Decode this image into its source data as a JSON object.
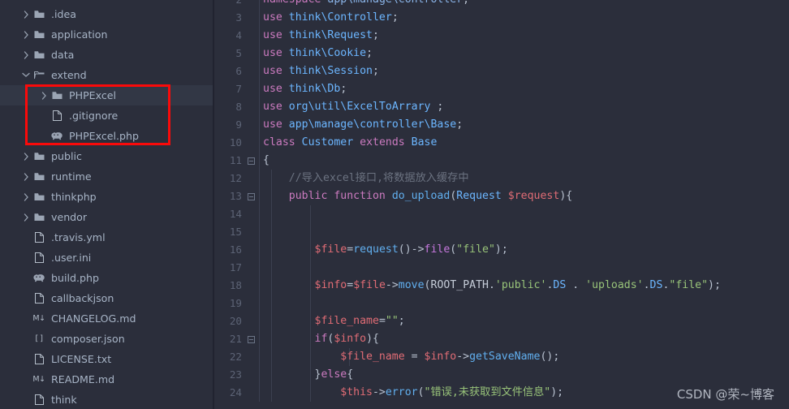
{
  "sidebar": {
    "name": "project-file-tree",
    "items": [
      {
        "label": ".idea",
        "indent": 1,
        "icon": "folder-icon",
        "arrow": "chevron-right",
        "selected": false
      },
      {
        "label": "application",
        "indent": 1,
        "icon": "folder-icon",
        "arrow": "chevron-right",
        "selected": false
      },
      {
        "label": "data",
        "indent": 1,
        "icon": "folder-icon",
        "arrow": "chevron-right",
        "selected": false
      },
      {
        "label": "extend",
        "indent": 1,
        "icon": "folder-open-icon",
        "arrow": "chevron-down",
        "selected": false
      },
      {
        "label": "PHPExcel",
        "indent": 2,
        "icon": "folder-icon",
        "arrow": "chevron-right",
        "selected": true
      },
      {
        "label": ".gitignore",
        "indent": 2,
        "icon": "file-icon",
        "arrow": "",
        "selected": false
      },
      {
        "label": "PHPExcel.php",
        "indent": 2,
        "icon": "php-elephant-icon",
        "arrow": "",
        "selected": false
      },
      {
        "label": "public",
        "indent": 1,
        "icon": "folder-icon",
        "arrow": "chevron-right",
        "selected": false
      },
      {
        "label": "runtime",
        "indent": 1,
        "icon": "folder-icon",
        "arrow": "chevron-right",
        "selected": false
      },
      {
        "label": "thinkphp",
        "indent": 1,
        "icon": "folder-icon",
        "arrow": "chevron-right",
        "selected": false
      },
      {
        "label": "vendor",
        "indent": 1,
        "icon": "folder-icon",
        "arrow": "chevron-right",
        "selected": false
      },
      {
        "label": ".travis.yml",
        "indent": 1,
        "icon": "file-icon",
        "arrow": "",
        "selected": false
      },
      {
        "label": ".user.ini",
        "indent": 1,
        "icon": "file-icon",
        "arrow": "",
        "selected": false
      },
      {
        "label": "build.php",
        "indent": 1,
        "icon": "php-elephant-icon",
        "arrow": "",
        "selected": false
      },
      {
        "label": "callbackjson",
        "indent": 1,
        "icon": "file-icon",
        "arrow": "",
        "selected": false
      },
      {
        "label": "CHANGELOG.md",
        "indent": 1,
        "icon": "markdown-icon",
        "arrow": "",
        "selected": false
      },
      {
        "label": "composer.json",
        "indent": 1,
        "icon": "json-icon",
        "arrow": "",
        "selected": false
      },
      {
        "label": "LICENSE.txt",
        "indent": 1,
        "icon": "file-icon",
        "arrow": "",
        "selected": false
      },
      {
        "label": "README.md",
        "indent": 1,
        "icon": "markdown-icon",
        "arrow": "",
        "selected": false
      },
      {
        "label": "think",
        "indent": 1,
        "icon": "file-icon",
        "arrow": "",
        "selected": false
      }
    ],
    "annotation": {
      "type": "red-rectangle",
      "color": "#fa0a0a"
    }
  },
  "editor": {
    "name": "php-code-editor",
    "language": "PHP",
    "first_visible_line": 2,
    "last_visible_line": 24,
    "lines": [
      {
        "n": 2,
        "fold": false,
        "tokens": [
          {
            "t": "namespace",
            "c": "kw"
          },
          {
            "t": " ",
            "c": "plain"
          },
          {
            "t": "app\\manage\\controller",
            "c": "ns"
          },
          {
            "t": ";",
            "c": "punc"
          }
        ]
      },
      {
        "n": 3,
        "fold": false,
        "tokens": [
          {
            "t": "use",
            "c": "kw"
          },
          {
            "t": " ",
            "c": "plain"
          },
          {
            "t": "think\\Controller",
            "c": "cls"
          },
          {
            "t": ";",
            "c": "punc"
          }
        ]
      },
      {
        "n": 4,
        "fold": false,
        "tokens": [
          {
            "t": "use",
            "c": "kw"
          },
          {
            "t": " ",
            "c": "plain"
          },
          {
            "t": "think\\Request",
            "c": "cls"
          },
          {
            "t": ";",
            "c": "punc"
          }
        ]
      },
      {
        "n": 5,
        "fold": false,
        "tokens": [
          {
            "t": "use",
            "c": "kw"
          },
          {
            "t": " ",
            "c": "plain"
          },
          {
            "t": "think\\Cookie",
            "c": "cls"
          },
          {
            "t": ";",
            "c": "punc"
          }
        ]
      },
      {
        "n": 6,
        "fold": false,
        "tokens": [
          {
            "t": "use",
            "c": "kw"
          },
          {
            "t": " ",
            "c": "plain"
          },
          {
            "t": "think\\Session",
            "c": "cls"
          },
          {
            "t": ";",
            "c": "punc"
          }
        ]
      },
      {
        "n": 7,
        "fold": false,
        "tokens": [
          {
            "t": "use",
            "c": "kw"
          },
          {
            "t": " ",
            "c": "plain"
          },
          {
            "t": "think\\Db",
            "c": "cls"
          },
          {
            "t": ";",
            "c": "punc"
          }
        ]
      },
      {
        "n": 8,
        "fold": false,
        "tokens": [
          {
            "t": "use",
            "c": "kw"
          },
          {
            "t": " ",
            "c": "plain"
          },
          {
            "t": "org\\util\\ExcelToArrary",
            "c": "cls"
          },
          {
            "t": " ;",
            "c": "punc"
          }
        ]
      },
      {
        "n": 9,
        "fold": false,
        "tokens": [
          {
            "t": "use",
            "c": "kw"
          },
          {
            "t": " ",
            "c": "plain"
          },
          {
            "t": "app\\manage\\controller\\Base",
            "c": "cls"
          },
          {
            "t": ";",
            "c": "punc"
          }
        ]
      },
      {
        "n": 10,
        "fold": false,
        "tokens": [
          {
            "t": "class",
            "c": "kw"
          },
          {
            "t": " ",
            "c": "plain"
          },
          {
            "t": "Customer",
            "c": "cls"
          },
          {
            "t": " ",
            "c": "plain"
          },
          {
            "t": "extends",
            "c": "kw"
          },
          {
            "t": " ",
            "c": "plain"
          },
          {
            "t": "Base",
            "c": "cls"
          }
        ]
      },
      {
        "n": 11,
        "fold": true,
        "tokens": [
          {
            "t": "{",
            "c": "punc"
          }
        ]
      },
      {
        "n": 12,
        "fold": false,
        "tokens": [
          {
            "t": "    //导入excel接口,将数据放入缓存中",
            "c": "cmt"
          }
        ]
      },
      {
        "n": 13,
        "fold": true,
        "tokens": [
          {
            "t": "    ",
            "c": "plain"
          },
          {
            "t": "public",
            "c": "kw"
          },
          {
            "t": " ",
            "c": "plain"
          },
          {
            "t": "function",
            "c": "kw"
          },
          {
            "t": " ",
            "c": "plain"
          },
          {
            "t": "do_upload",
            "c": "fn"
          },
          {
            "t": "(",
            "c": "punc"
          },
          {
            "t": "Request",
            "c": "cls"
          },
          {
            "t": " ",
            "c": "plain"
          },
          {
            "t": "$request",
            "c": "var"
          },
          {
            "t": "){",
            "c": "punc"
          }
        ]
      },
      {
        "n": 14,
        "fold": false,
        "tokens": []
      },
      {
        "n": 15,
        "fold": false,
        "tokens": []
      },
      {
        "n": 16,
        "fold": false,
        "tokens": [
          {
            "t": "        ",
            "c": "plain"
          },
          {
            "t": "$file",
            "c": "var"
          },
          {
            "t": "=",
            "c": "punc"
          },
          {
            "t": "request",
            "c": "fn"
          },
          {
            "t": "()->",
            "c": "punc"
          },
          {
            "t": "file",
            "c": "mth"
          },
          {
            "t": "(",
            "c": "punc"
          },
          {
            "t": "\"file\"",
            "c": "str"
          },
          {
            "t": ");",
            "c": "punc"
          }
        ]
      },
      {
        "n": 17,
        "fold": false,
        "tokens": []
      },
      {
        "n": 18,
        "fold": false,
        "tokens": [
          {
            "t": "        ",
            "c": "plain"
          },
          {
            "t": "$info",
            "c": "var"
          },
          {
            "t": "=",
            "c": "punc"
          },
          {
            "t": "$file",
            "c": "var"
          },
          {
            "t": "->",
            "c": "punc"
          },
          {
            "t": "move",
            "c": "fn"
          },
          {
            "t": "(",
            "c": "punc"
          },
          {
            "t": "ROOT_PATH",
            "c": "const"
          },
          {
            "t": ".",
            "c": "punc"
          },
          {
            "t": "'public'",
            "c": "str"
          },
          {
            "t": ".",
            "c": "punc"
          },
          {
            "t": "DS",
            "c": "cls"
          },
          {
            "t": " . ",
            "c": "punc"
          },
          {
            "t": "'uploads'",
            "c": "str"
          },
          {
            "t": ".",
            "c": "punc"
          },
          {
            "t": "DS",
            "c": "cls"
          },
          {
            "t": ".",
            "c": "punc"
          },
          {
            "t": "\"file\"",
            "c": "str"
          },
          {
            "t": ");",
            "c": "punc"
          }
        ]
      },
      {
        "n": 19,
        "fold": false,
        "tokens": []
      },
      {
        "n": 20,
        "fold": false,
        "tokens": [
          {
            "t": "        ",
            "c": "plain"
          },
          {
            "t": "$file_name",
            "c": "var"
          },
          {
            "t": "=",
            "c": "punc"
          },
          {
            "t": "\"\"",
            "c": "str"
          },
          {
            "t": ";",
            "c": "punc"
          }
        ]
      },
      {
        "n": 21,
        "fold": true,
        "tokens": [
          {
            "t": "        ",
            "c": "plain"
          },
          {
            "t": "if",
            "c": "kw"
          },
          {
            "t": "(",
            "c": "punc"
          },
          {
            "t": "$info",
            "c": "var"
          },
          {
            "t": "){",
            "c": "punc"
          }
        ]
      },
      {
        "n": 22,
        "fold": false,
        "tokens": [
          {
            "t": "            ",
            "c": "plain"
          },
          {
            "t": "$file_name",
            "c": "var"
          },
          {
            "t": " = ",
            "c": "punc"
          },
          {
            "t": "$info",
            "c": "var"
          },
          {
            "t": "->",
            "c": "punc"
          },
          {
            "t": "getSaveName",
            "c": "fn"
          },
          {
            "t": "();",
            "c": "punc"
          }
        ]
      },
      {
        "n": 23,
        "fold": false,
        "tokens": [
          {
            "t": "        ",
            "c": "plain"
          },
          {
            "t": "}",
            "c": "punc"
          },
          {
            "t": "else",
            "c": "kw"
          },
          {
            "t": "{",
            "c": "punc"
          }
        ]
      },
      {
        "n": 24,
        "fold": false,
        "tokens": [
          {
            "t": "            ",
            "c": "plain"
          },
          {
            "t": "$this",
            "c": "var"
          },
          {
            "t": "->",
            "c": "punc"
          },
          {
            "t": "error",
            "c": "fn"
          },
          {
            "t": "(",
            "c": "punc"
          },
          {
            "t": "\"错误,未获取到文件信息\"",
            "c": "str"
          },
          {
            "t": ");",
            "c": "punc"
          }
        ]
      }
    ]
  },
  "watermark": {
    "text": "CSDN @荣~博客"
  }
}
